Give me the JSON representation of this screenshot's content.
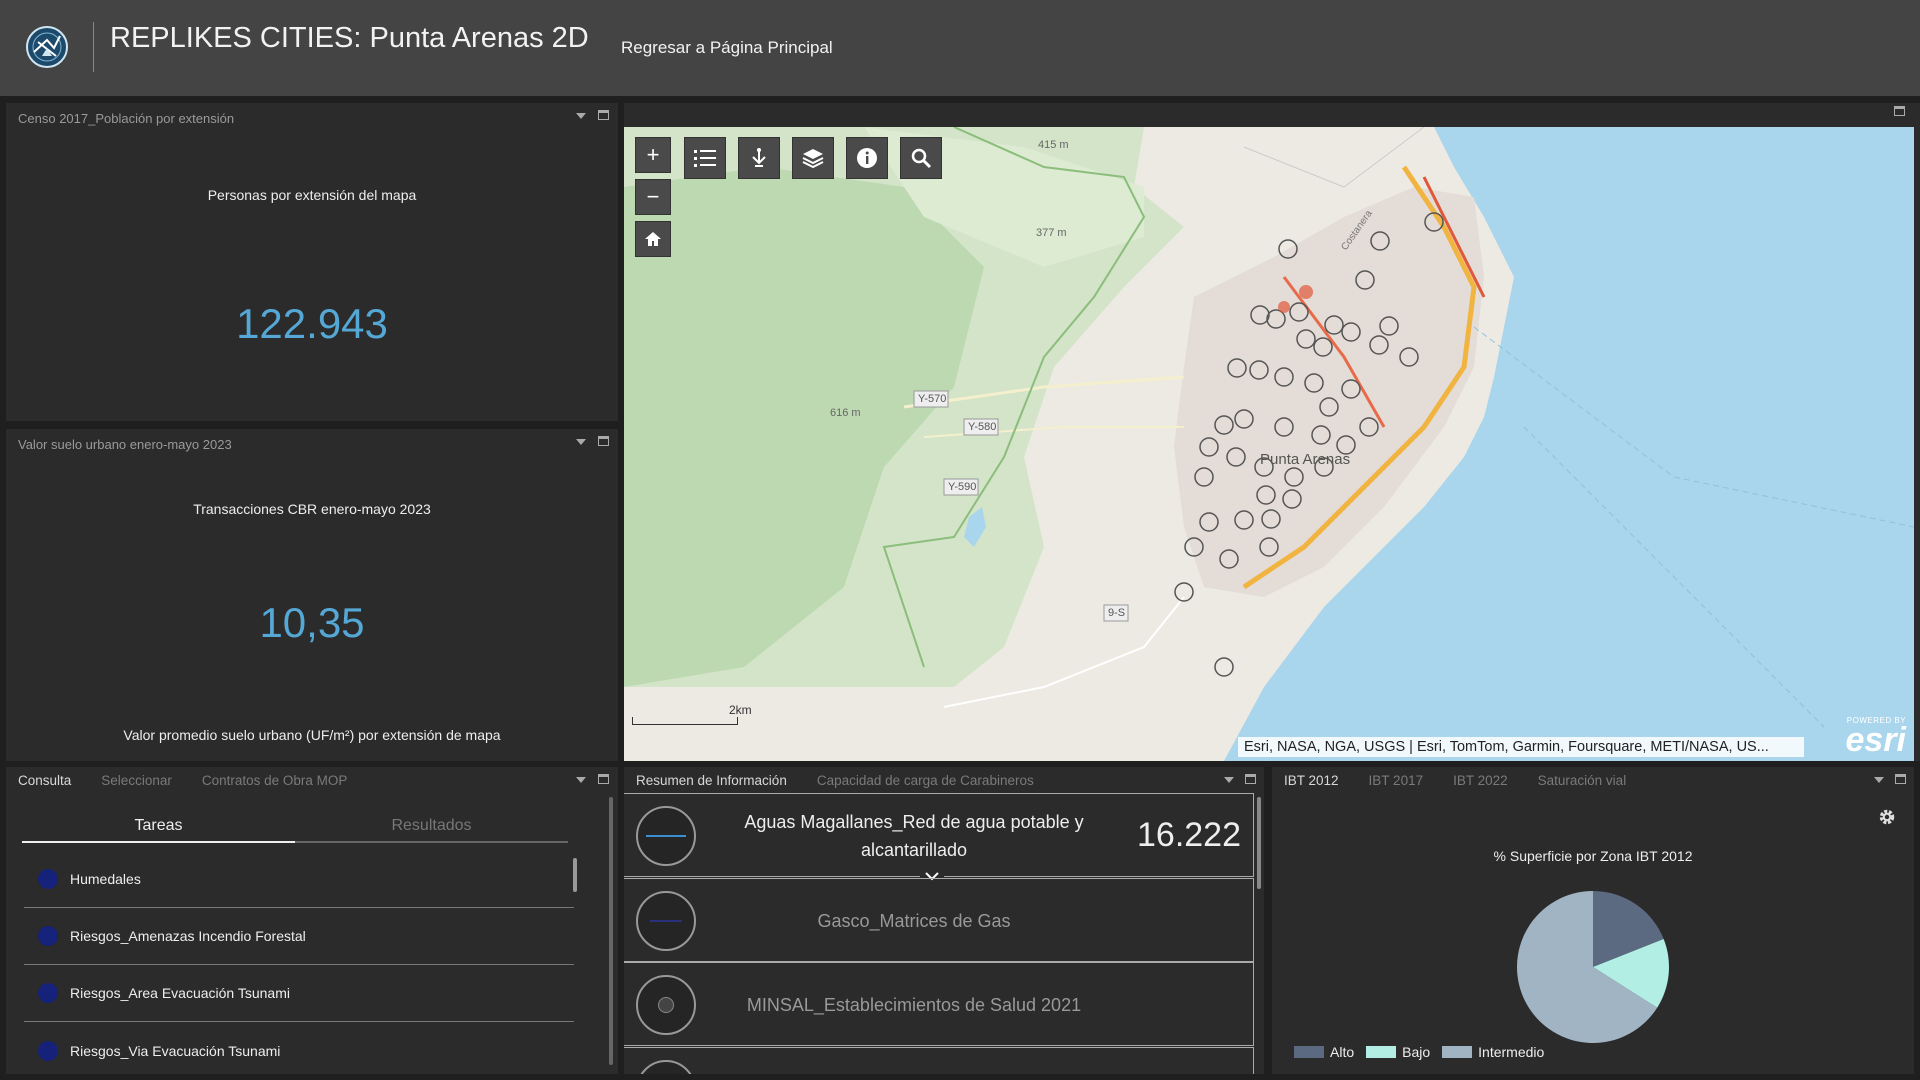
{
  "header": {
    "title": "REPLIKES CITIES: Punta Arenas 2D",
    "home_link": "Regresar a Página Principal"
  },
  "censo": {
    "title": "Censo 2017_Población por extensión",
    "label": "Personas por extensión del mapa",
    "value": "122.943"
  },
  "suelo": {
    "title": "Valor suelo urbano enero-mayo 2023",
    "label": "Transacciones CBR enero-mayo 2023",
    "value": "10,35",
    "footer": "Valor promedio suelo urbano (UF/m²) por extensión de mapa"
  },
  "map": {
    "labels": {
      "city": "Punta Arenas",
      "e415": "415 m",
      "e377": "377 m",
      "e616": "616 m",
      "y570": "Y-570",
      "y580": "Y-580",
      "y590": "Y-590",
      "r9s": "9-S",
      "coast": "Costanera"
    },
    "scale": "2km",
    "attribution": "Esri, NASA, NGA, USGS | Esri, TomTom, Garmin, Foursquare, METI/NASA, US...",
    "powered_by": "POWERED BY",
    "esri": "esri"
  },
  "consulta": {
    "tabs": [
      "Consulta",
      "Seleccionar",
      "Contratos de Obra MOP"
    ],
    "subtabs": [
      "Tareas",
      "Resultados"
    ],
    "tasks": [
      "Humedales",
      "Riesgos_Amenazas Incendio Forestal",
      "Riesgos_Area Evacuación Tsunami",
      "Riesgos_Via Evacuación Tsunami"
    ]
  },
  "resumen": {
    "tabs": [
      "Resumen de Información",
      "Capacidad de carga de Carabineros"
    ],
    "rows": [
      {
        "name": "Aguas Magallanes_Red de agua potable y alcantarillado",
        "value": "16.222"
      },
      {
        "name": "Gasco_Matrices de Gas",
        "value": ""
      },
      {
        "name": "MINSAL_Establecimientos de Salud 2021",
        "value": ""
      }
    ]
  },
  "ibt": {
    "tabs": [
      "IBT 2012",
      "IBT 2017",
      "IBT 2022",
      "Saturación vial"
    ],
    "title": "% Superficie por Zona IBT 2012"
  },
  "chart_data": {
    "type": "pie",
    "title": "% Superficie por Zona IBT 2012",
    "categories": [
      "Alto",
      "Bajo",
      "Intermedio"
    ],
    "values": [
      19,
      15,
      66
    ],
    "colors": [
      "#5b6a80",
      "#b2eee3",
      "#a1b4c4"
    ],
    "legend": "bottom"
  }
}
